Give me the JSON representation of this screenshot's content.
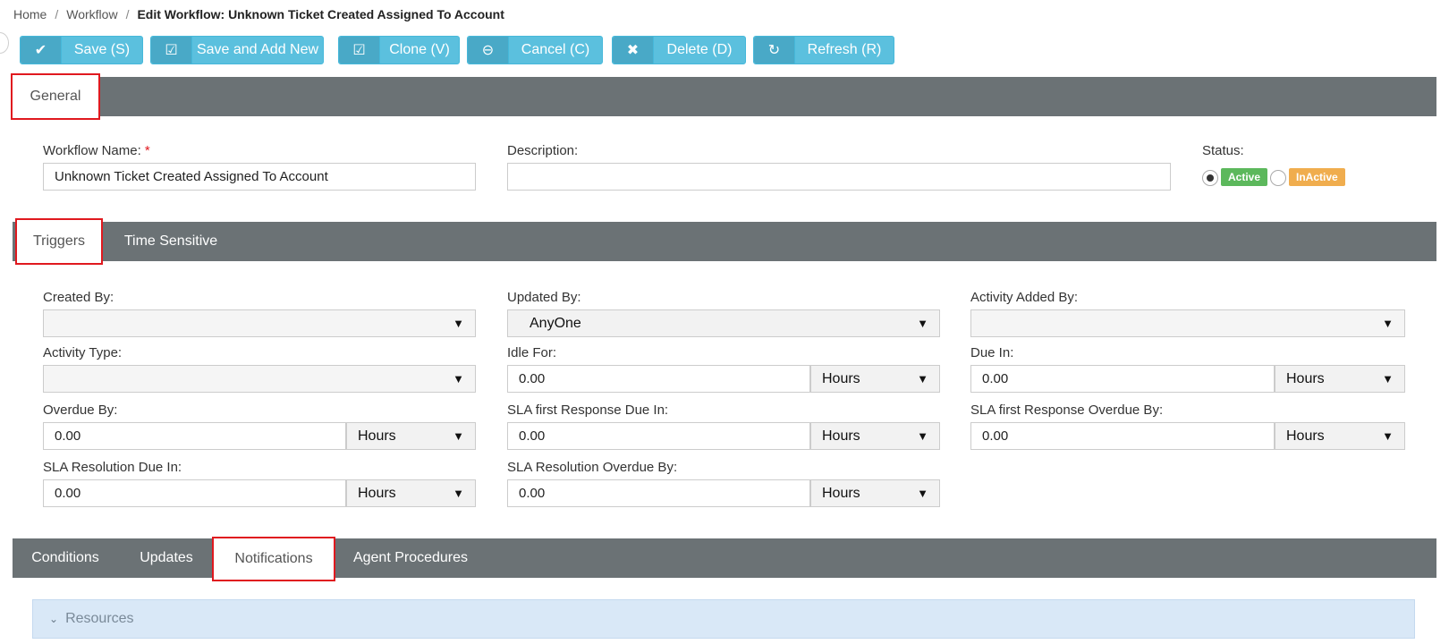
{
  "breadcrumb": {
    "home": "Home",
    "workflow": "Workflow",
    "current": "Edit Workflow: Unknown Ticket Created Assigned To Account",
    "sep": "/"
  },
  "toolbar": {
    "save": "Save (S)",
    "save_add_new": "Save and Add New",
    "clone": "Clone (V)",
    "cancel": "Cancel (C)",
    "delete": "Delete (D)",
    "refresh": "Refresh (R)",
    "icons": {
      "save": "✔",
      "save_add_new": "☑",
      "clone": "☑",
      "cancel": "⊖",
      "delete": "✖",
      "refresh": "↻"
    }
  },
  "general_tabs": {
    "general": "General"
  },
  "general": {
    "workflow_name_label": "Workflow Name:",
    "required_mark": "*",
    "workflow_name_value": "Unknown Ticket Created Assigned To Account",
    "description_label": "Description:",
    "description_value": "",
    "status_label": "Status:",
    "status_active": "Active",
    "status_inactive": "InActive",
    "status_selected": "Active"
  },
  "trigger_tabs": {
    "triggers": "Triggers",
    "time_sensitive": "Time Sensitive"
  },
  "triggers": {
    "created_by_label": "Created By:",
    "created_by_value": "",
    "updated_by_label": "Updated By:",
    "updated_by_value": "AnyOne",
    "activity_added_by_label": "Activity Added By:",
    "activity_added_by_value": "",
    "activity_type_label": "Activity Type:",
    "activity_type_value": "",
    "idle_for_label": "Idle For:",
    "idle_for_value": "0.00",
    "idle_for_unit": "Hours",
    "due_in_label": "Due In:",
    "due_in_value": "0.00",
    "due_in_unit": "Hours",
    "overdue_by_label": "Overdue By:",
    "overdue_by_value": "0.00",
    "overdue_by_unit": "Hours",
    "sla_first_response_due_in_label": "SLA first Response Due In:",
    "sla_first_response_due_in_value": "0.00",
    "sla_first_response_due_in_unit": "Hours",
    "sla_first_response_overdue_by_label": "SLA first Response Overdue By:",
    "sla_first_response_overdue_by_value": "0.00",
    "sla_first_response_overdue_by_unit": "Hours",
    "sla_resolution_due_in_label": "SLA Resolution Due In:",
    "sla_resolution_due_in_value": "0.00",
    "sla_resolution_due_in_unit": "Hours",
    "sla_resolution_overdue_by_label": "SLA Resolution Overdue By:",
    "sla_resolution_overdue_by_value": "0.00",
    "sla_resolution_overdue_by_unit": "Hours",
    "dropdown_arrow": "▼"
  },
  "action_tabs": {
    "conditions": "Conditions",
    "updates": "Updates",
    "notifications": "Notifications",
    "agent_procedures": "Agent Procedures"
  },
  "resources": {
    "label": "Resources",
    "chevron": "⌄"
  },
  "colors": {
    "primary_button": "#5bc0de",
    "bar": "#6b7275",
    "highlight": "#e0191f",
    "active_badge": "#5cb85c",
    "inactive_badge": "#f0ad4e",
    "resources_bg": "#d9e8f7"
  }
}
